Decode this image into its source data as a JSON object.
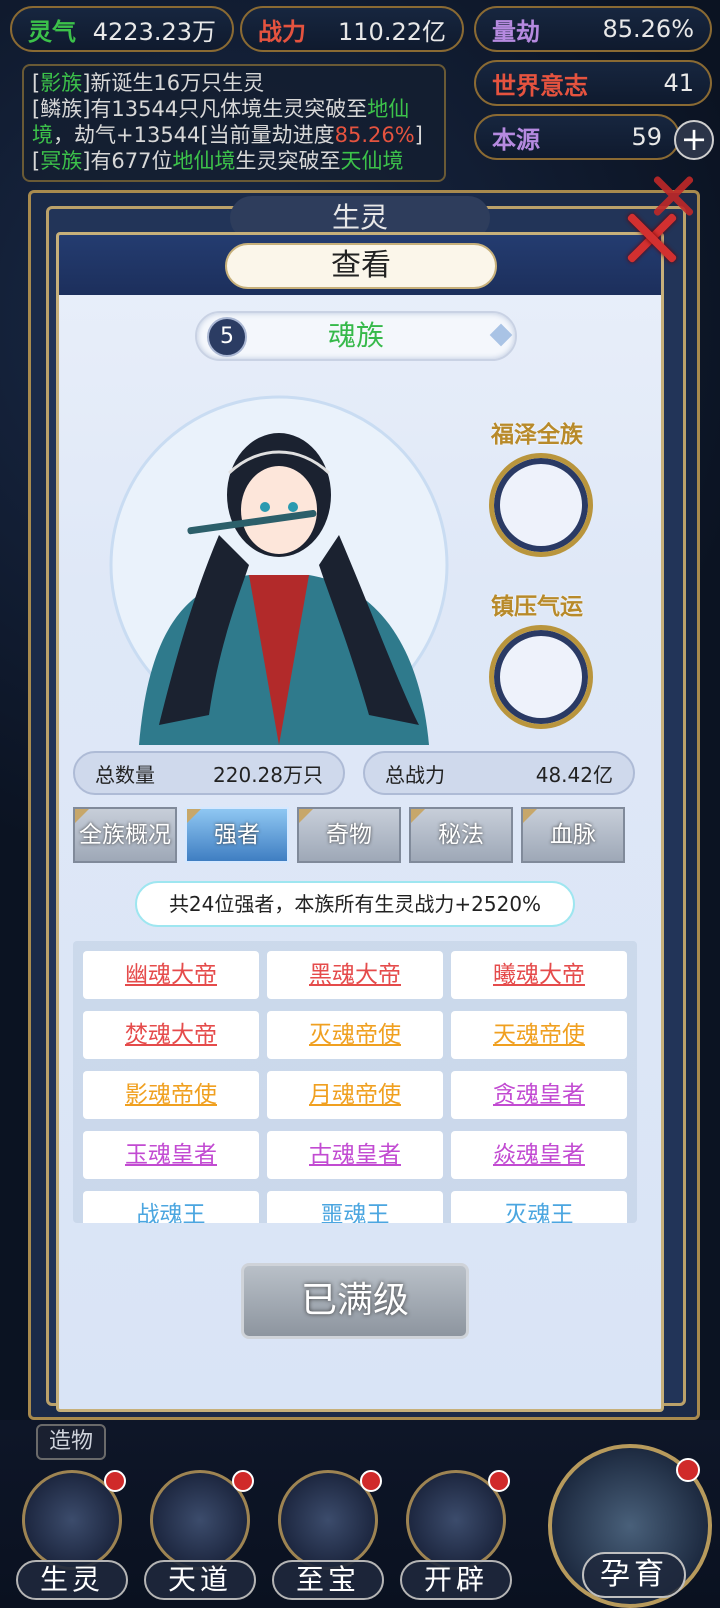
{
  "top_stats": [
    {
      "key": "灵气",
      "value": "4223.23万",
      "key_color": "#3cc24a"
    },
    {
      "key": "战力",
      "value": "110.22亿",
      "key_color": "#e5533f"
    },
    {
      "key": "量劫",
      "value": "85.26%",
      "key_color": "#b68ae0"
    }
  ],
  "world_will": {
    "key": "世界意志",
    "value": "41",
    "key_color": "#e5533f"
  },
  "origin": {
    "key": "本源",
    "value": "59",
    "key_color": "#b68ae0"
  },
  "log": {
    "line1_race": "影族",
    "line1_text": "新诞生16万只生灵",
    "line2_race": "鳞族",
    "line2_a": "有13544只凡体境生灵突破至",
    "line2_realm": "地仙境",
    "line2_b": "，劫气+13544[当前量劫进度",
    "line2_pct": "85.26%",
    "line2_c": "]",
    "line3_race": "冥族",
    "line3_a": "有677位",
    "line3_realm1": "地仙境",
    "line3_b": "生灵突破至",
    "line3_realm2": "天仙境"
  },
  "back_tab": "生灵",
  "dialog": {
    "title": "查看",
    "race_index": "5",
    "race_name": "魂族",
    "blessing_label": "福泽全族",
    "suppress_label": "镇压气运",
    "total_count_label": "总数量",
    "total_count_value": "220.28万只",
    "total_power_label": "总战力",
    "total_power_value": "48.42亿",
    "tabs": [
      "全族概况",
      "强者",
      "奇物",
      "秘法",
      "血脉"
    ],
    "active_tab": "强者",
    "info_text": "共24位强者，本族所有生灵战力+2520%",
    "strongmen": [
      {
        "name": "幽魂大帝",
        "color": "red"
      },
      {
        "name": "黑魂大帝",
        "color": "red"
      },
      {
        "name": "曦魂大帝",
        "color": "red"
      },
      {
        "name": "焚魂大帝",
        "color": "red"
      },
      {
        "name": "灭魂帝使",
        "color": "orange"
      },
      {
        "name": "天魂帝使",
        "color": "orange"
      },
      {
        "name": "影魂帝使",
        "color": "orange"
      },
      {
        "name": "月魂帝使",
        "color": "orange"
      },
      {
        "name": "贪魂皇者",
        "color": "purple"
      },
      {
        "name": "玉魂皇者",
        "color": "purple"
      },
      {
        "name": "古魂皇者",
        "color": "purple"
      },
      {
        "name": "焱魂皇者",
        "color": "purple"
      },
      {
        "name": "战魂王",
        "color": "blue"
      },
      {
        "name": "噩魂王",
        "color": "blue"
      },
      {
        "name": "灭魂王",
        "color": "blue"
      }
    ],
    "max_button": "已满级"
  },
  "zaowu": "造物",
  "nav": [
    {
      "label": "生灵",
      "icon": "lotus-icon"
    },
    {
      "label": "天道",
      "icon": "swirl-icon"
    },
    {
      "label": "至宝",
      "icon": "treasure-icon"
    },
    {
      "label": "开辟",
      "icon": "mountain-icon"
    }
  ],
  "nurture": {
    "label": "孕育",
    "icon": "figure-icon"
  }
}
